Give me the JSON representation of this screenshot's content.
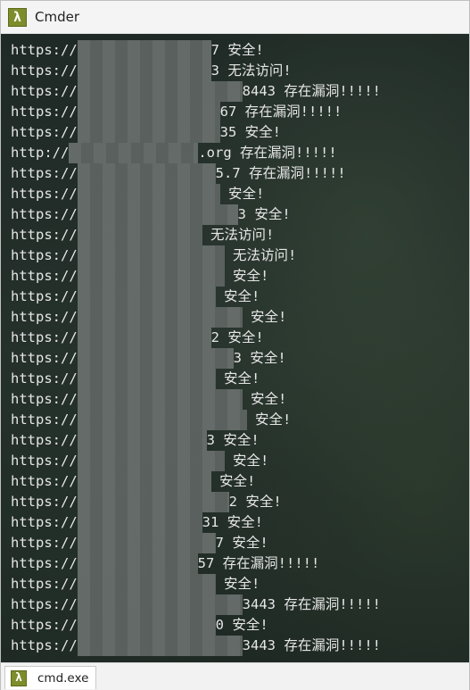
{
  "window": {
    "title": "Cmder",
    "icon": "lambda-icon",
    "accent": "#7d8d2b"
  },
  "console": {
    "lines": [
      {
        "prefix": "https://",
        "tail": "7",
        "status": "安全!"
      },
      {
        "prefix": "https://",
        "tail": "3",
        "status": "无法访问!"
      },
      {
        "prefix": "https://",
        "tail": "8443",
        "status": "存在漏洞!!!!!"
      },
      {
        "prefix": "https://",
        "tail": "67",
        "status": "存在漏洞!!!!!"
      },
      {
        "prefix": "https://",
        "tail": "35",
        "status": "安全!"
      },
      {
        "prefix": "http://",
        "tail": ".org",
        "status": "存在漏洞!!!!!"
      },
      {
        "prefix": "https://",
        "tail": "5.7",
        "status": "存在漏洞!!!!!"
      },
      {
        "prefix": "https://",
        "tail": "",
        "status": "安全!"
      },
      {
        "prefix": "https://",
        "tail": "3",
        "status": "安全!"
      },
      {
        "prefix": "https://",
        "tail": "",
        "status": "无法访问!"
      },
      {
        "prefix": "https://",
        "tail": "",
        "status": "无法访问!"
      },
      {
        "prefix": "https://",
        "tail": "",
        "status": "安全!"
      },
      {
        "prefix": "https://",
        "tail": "",
        "status": "安全!"
      },
      {
        "prefix": "https://",
        "tail": "",
        "status": "安全!"
      },
      {
        "prefix": "https://",
        "tail": "2",
        "status": "安全!"
      },
      {
        "prefix": "https://",
        "tail": "3",
        "status": "安全!"
      },
      {
        "prefix": "https://",
        "tail": "",
        "status": "安全!"
      },
      {
        "prefix": "https://",
        "tail": "",
        "status": "安全!"
      },
      {
        "prefix": "https://",
        "tail": "",
        "status": "安全!"
      },
      {
        "prefix": "https://",
        "tail": "3",
        "status": "安全!"
      },
      {
        "prefix": "https://",
        "tail": "",
        "status": "安全!"
      },
      {
        "prefix": "https://",
        "tail": "",
        "status": "安全!"
      },
      {
        "prefix": "https://",
        "tail": "2",
        "status": "安全!"
      },
      {
        "prefix": "https://",
        "tail": "31",
        "status": "安全!"
      },
      {
        "prefix": "https://",
        "tail": "7",
        "status": "安全!"
      },
      {
        "prefix": "https://",
        "tail": "57",
        "status": "存在漏洞!!!!!"
      },
      {
        "prefix": "https://",
        "tail": "",
        "status": "安全!"
      },
      {
        "prefix": "https://",
        "tail": "3443",
        "status": "存在漏洞!!!!!"
      },
      {
        "prefix": "https://",
        "tail": "0",
        "status": "安全!"
      },
      {
        "prefix": "https://",
        "tail": "3443",
        "status": "存在漏洞!!!!!"
      }
    ]
  },
  "tabbar": {
    "tabs": [
      {
        "label": "cmd.exe",
        "icon": "lambda-icon"
      }
    ]
  }
}
